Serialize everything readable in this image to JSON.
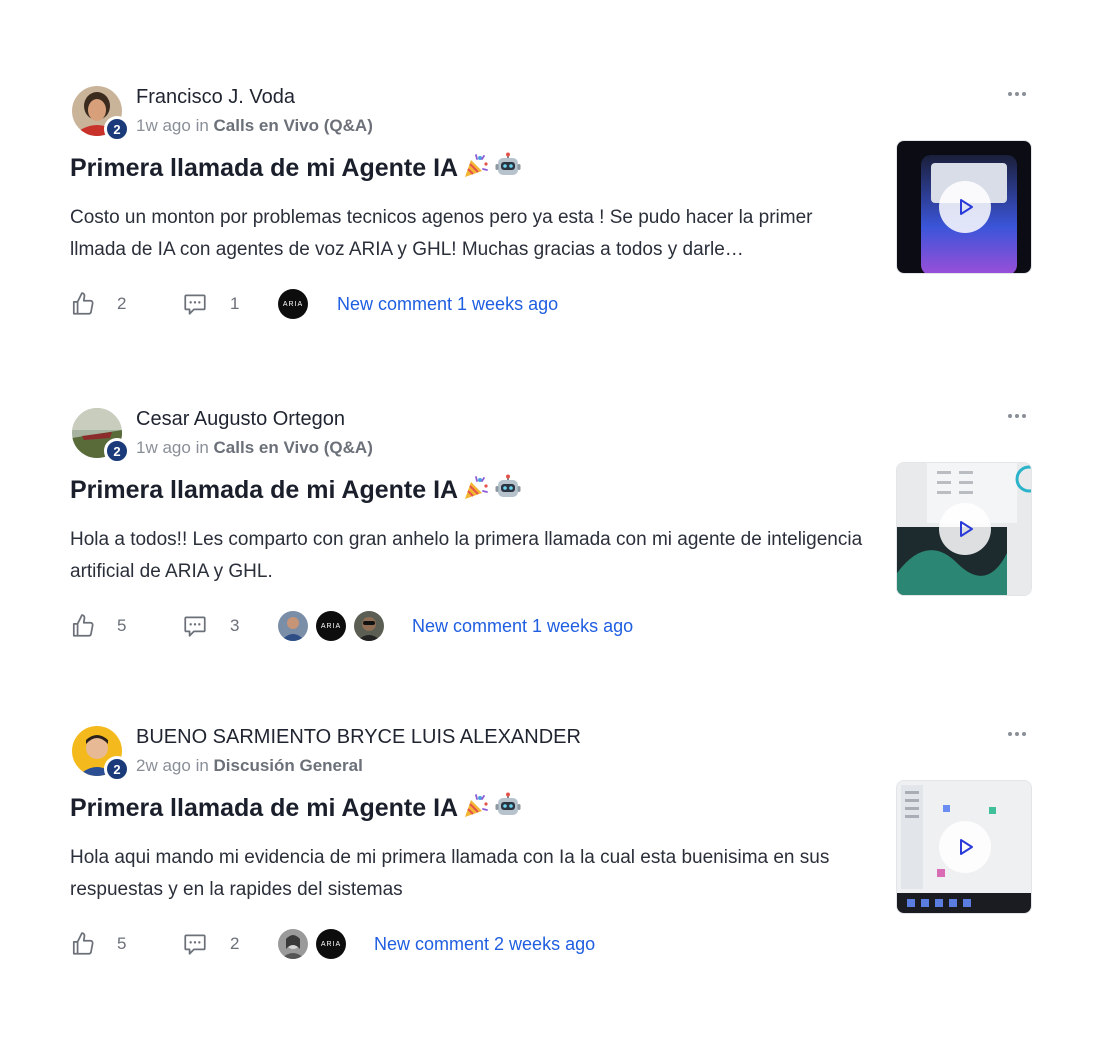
{
  "posts": [
    {
      "author": "Francisco J. Voda",
      "level": "2",
      "time": "1w ago",
      "in_word": "in",
      "category": "Calls en Vivo (Q&A)",
      "title": "Primera llamada de mi Agente IA",
      "body": "Costo un monton por problemas tecnicos agenos pero ya esta ! Se pudo hacer la primer llmada de IA con agentes de voz ARIA y GHL! Muchas gracias a todos y darle…",
      "likes": "2",
      "comments": "1",
      "commenter_avatars": [
        "ARIA"
      ],
      "new_comment": "New comment 1 weeks ago"
    },
    {
      "author": "Cesar Augusto Ortegon",
      "level": "2",
      "time": "1w ago",
      "in_word": "in",
      "category": "Calls en Vivo (Q&A)",
      "title": "Primera llamada de mi Agente IA",
      "body": "Hola a todos!! Les comparto con gran anhelo la primera llamada con mi agente de inteligencia artificial de ARIA y GHL.",
      "likes": "5",
      "comments": "3",
      "commenter_avatars": [
        "ARIA"
      ],
      "new_comment": "New comment 1 weeks ago"
    },
    {
      "author": "BUENO SARMIENTO BRYCE LUIS ALEXANDER",
      "level": "2",
      "time": "2w ago",
      "in_word": "in",
      "category": "Discusión General",
      "title": "Primera llamada de mi Agente IA",
      "body": "Hola aqui mando mi evidencia de mi primera llamada con Ia la cual esta buenisima en sus respuestas y en la rapides del sistemas",
      "likes": "5",
      "comments": "2",
      "commenter_avatars": [
        "ARIA"
      ],
      "new_comment": "New comment 2 weeks ago"
    }
  ],
  "icons": {
    "like": "thumbs-up-icon",
    "comment": "comment-icon",
    "more": "more-dots-icon",
    "play": "play-icon",
    "title_emojis": [
      "party-popper-emoji",
      "robot-emoji"
    ]
  },
  "colors": {
    "link": "#1f5ee0",
    "level_badge": "#1a3a7a",
    "muted": "#8a8f98"
  }
}
